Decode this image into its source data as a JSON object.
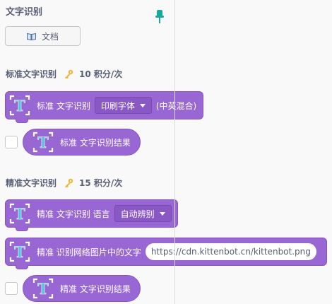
{
  "category": {
    "title": "文字识别"
  },
  "doc_button": {
    "label": "文档",
    "icon": "book-icon"
  },
  "standard": {
    "section_label": "标准文字识别",
    "cost": "10 积分/次",
    "block": {
      "label": "标准 文字识别",
      "dropdown_value": "印刷字体",
      "suffix": "(中英混合)"
    },
    "reporter": {
      "label": "标准 文字识别结果"
    }
  },
  "precise": {
    "section_label": "精准文字识别",
    "cost": "15 积分/次",
    "block_lang": {
      "label": "精准 文字识别 语言",
      "dropdown_value": "自动辨别"
    },
    "block_url": {
      "label": "精准 识别网络图片中的文字",
      "input_value": "https://cdn.kittenbot.cn/kittenbot.png"
    },
    "reporter": {
      "label": "精准 文字识别结果"
    }
  },
  "colors": {
    "block": "#9967d3",
    "block_border": "#8754c2",
    "dropdown": "#8a58c4",
    "text_gray": "#575e75",
    "pin": "#17a9a0",
    "key": "#f2b632"
  }
}
